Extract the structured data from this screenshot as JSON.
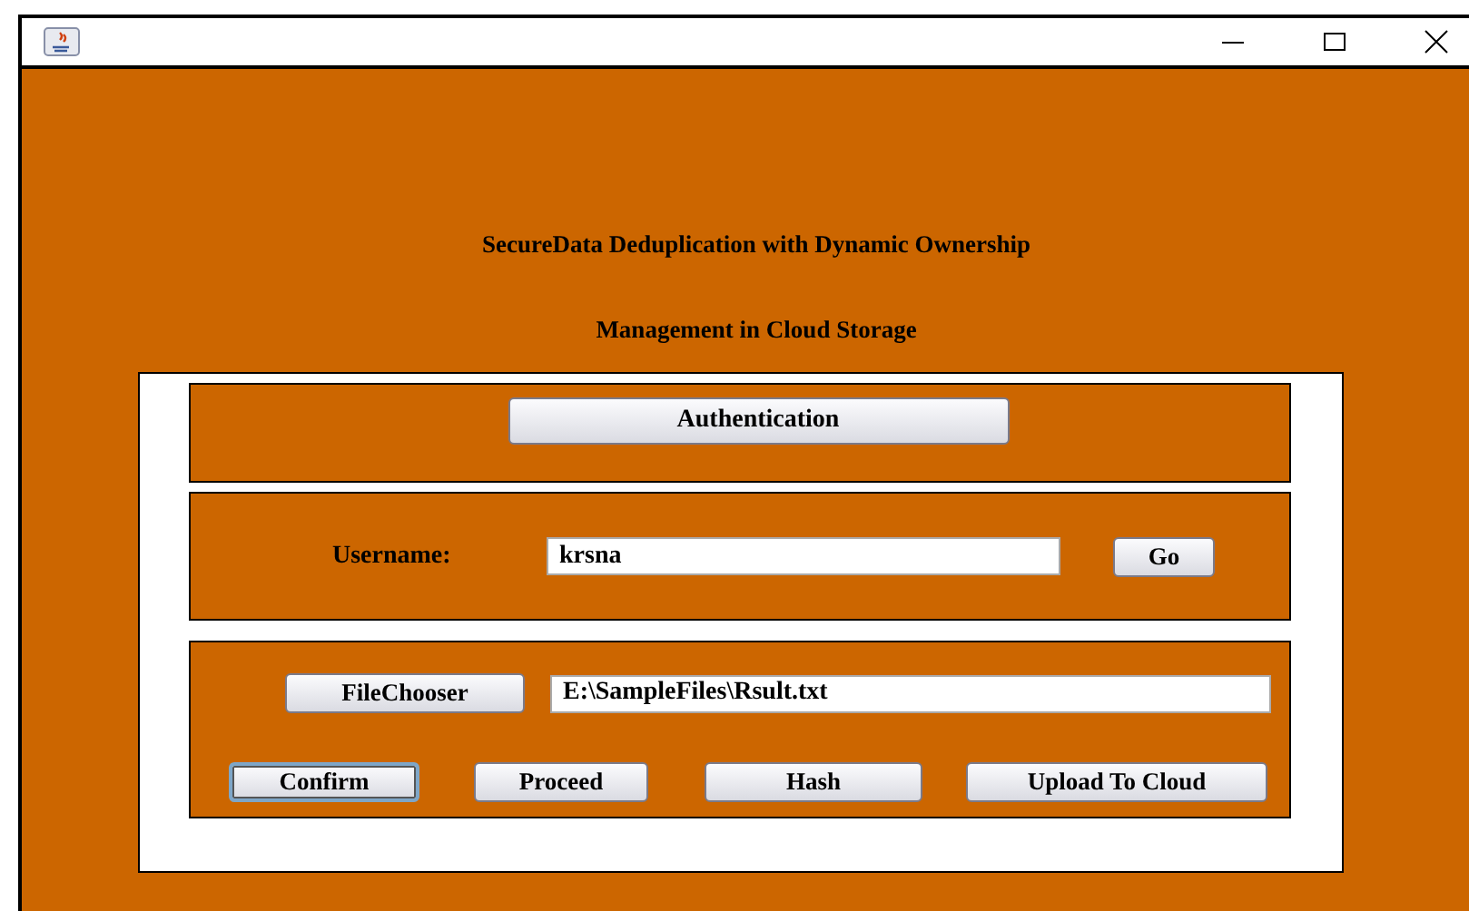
{
  "window": {
    "title_lines": [
      "SecureData Deduplication with Dynamic Ownership",
      "Management in Cloud Storage"
    ]
  },
  "authentication_button": "Authentication",
  "user": {
    "label": "Username:",
    "value": "krsna",
    "button": "Go"
  },
  "file": {
    "button": "FileChooser",
    "value": "E:\\SampleFiles\\Rsult.txt"
  },
  "actions": [
    {
      "label": "Confirm",
      "focused": true
    },
    {
      "label": "Proceed",
      "focused": false
    },
    {
      "label": "Hash",
      "focused": false
    },
    {
      "label": "Upload To Cloud",
      "focused": false
    }
  ]
}
